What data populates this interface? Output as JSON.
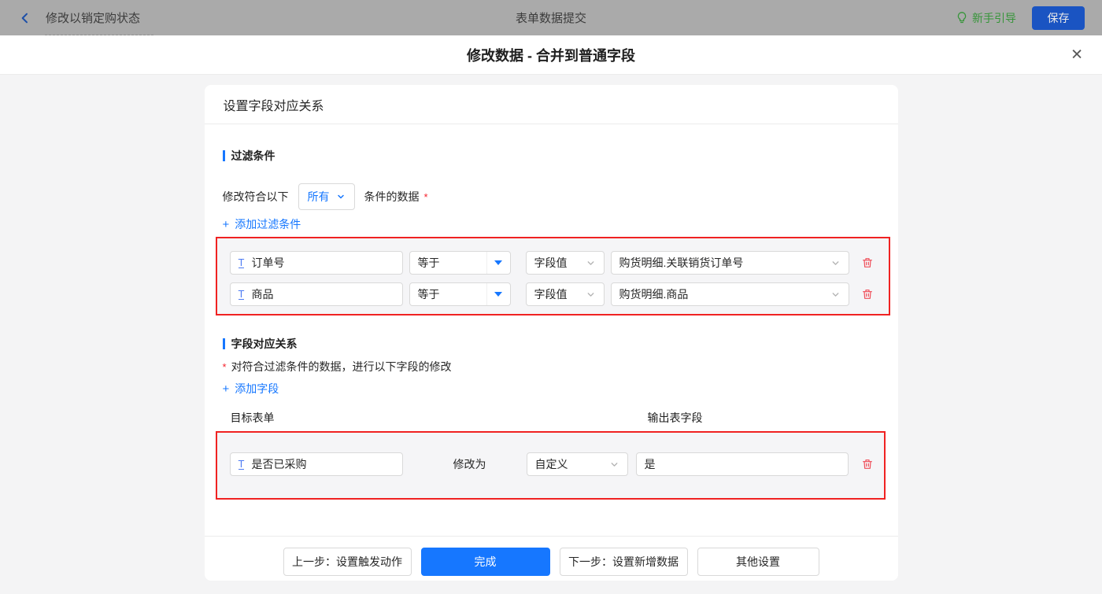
{
  "topbar": {
    "back_title": "修改以销定购状态",
    "center_title": "表单数据提交",
    "guide_label": "新手引导",
    "save_label": "保存"
  },
  "dialog": {
    "title": "修改数据 - 合并到普通字段"
  },
  "icons": {
    "plus": "+",
    "close": "✕",
    "text_field": "T"
  },
  "card": {
    "header": "设置字段对应关系",
    "filter_section": {
      "title": "过滤条件",
      "prefix": "修改符合以下",
      "match_select": "所有",
      "suffix": "条件的数据",
      "required_mark": "*",
      "add_label": "添加过滤条件",
      "rows": [
        {
          "field": "订单号",
          "operator": "等于",
          "value_type": "字段值",
          "value": "购货明细.关联销货订单号"
        },
        {
          "field": "商品",
          "operator": "等于",
          "value_type": "字段值",
          "value": "购货明细.商品"
        }
      ]
    },
    "mapping_section": {
      "title": "字段对应关系",
      "required_mark": "*",
      "description": "对符合过滤条件的数据，进行以下字段的修改",
      "add_label": "添加字段",
      "col_target": "目标表单",
      "col_output": "输出表字段",
      "rows": [
        {
          "field": "是否已采购",
          "action": "修改为",
          "mode": "自定义",
          "value": "是"
        }
      ]
    },
    "footer": {
      "prev_label": "上一步：设置触发动作",
      "done_label": "完成",
      "next_label": "下一步：设置新增数据",
      "other_label": "其他设置"
    }
  },
  "colors": {
    "accent_blue": "#1677ff",
    "annotation_red": "#f02222",
    "delete_red": "#ef4f5a",
    "guide_green": "#37953a",
    "save_button_blue": "#1a54c2",
    "topbar_gray": "#aaaaaa",
    "page_bg": "#f4f4f5"
  }
}
